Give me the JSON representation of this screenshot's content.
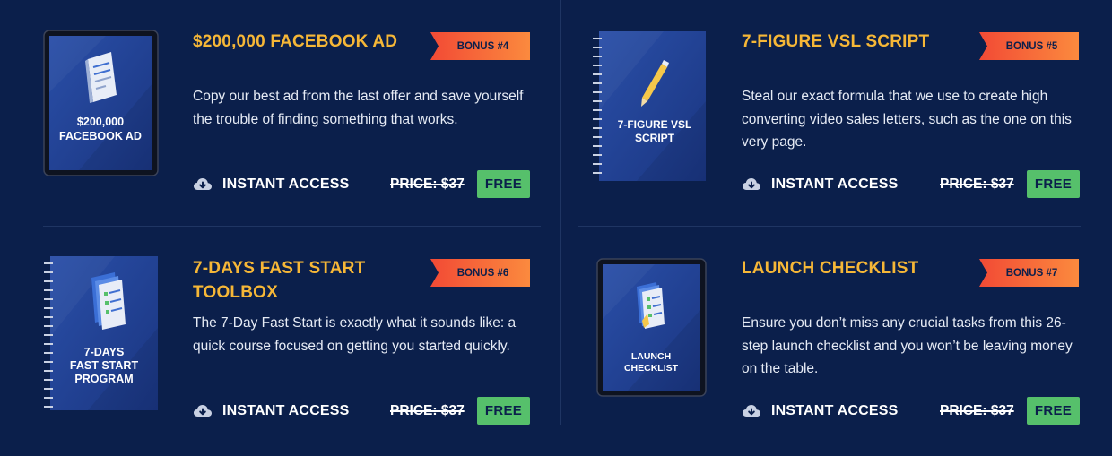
{
  "colors": {
    "background": "#0b1f4b",
    "title": "#f6b737",
    "ribbon_start": "#f24a35",
    "ribbon_end": "#fb8a3e",
    "free_badge": "#56c06b"
  },
  "bonuses": [
    {
      "title": "$200,000 FACEBOOK AD",
      "badge": "BONUS #4",
      "description": "Copy our best ad from the last offer and save yourself the trouble of finding something that works.",
      "access_label": "INSTANT ACCESS",
      "price": "PRICE: $37",
      "free_label": "FREE",
      "cover_lines": [
        "$200,000",
        "FACEBOOK AD"
      ],
      "cover_icon": "document-icon"
    },
    {
      "title": "7-FIGURE VSL SCRIPT",
      "badge": "BONUS #5",
      "description": "Steal our exact formula that we use to create high converting video sales letters, such as the one on this very page.",
      "access_label": "INSTANT ACCESS",
      "price": "PRICE: $37",
      "free_label": "FREE",
      "cover_lines": [
        "7-FIGURE VSL",
        "SCRIPT"
      ],
      "cover_icon": "pencil-icon"
    },
    {
      "title": "7-DAYS FAST START TOOLBOX",
      "badge": "BONUS #6",
      "description": "The 7-Day Fast Start is exactly what it sounds like: a quick course focused on getting you started quickly.",
      "access_label": "INSTANT ACCESS",
      "price": "PRICE: $37",
      "free_label": "FREE",
      "cover_lines": [
        "7-DAYS",
        "FAST START",
        "PROGRAM"
      ],
      "cover_icon": "checklist-icon"
    },
    {
      "title": "LAUNCH CHECKLIST",
      "badge": "BONUS #7",
      "description": "Ensure you don’t miss any crucial tasks from this 26-step launch checklist and you won’t be leaving money on the table.",
      "access_label": "INSTANT ACCESS",
      "price": "PRICE: $37",
      "free_label": "FREE",
      "cover_lines": [
        "LAUNCH",
        "CHECKLIST"
      ],
      "cover_icon": "checklist-icon"
    }
  ]
}
